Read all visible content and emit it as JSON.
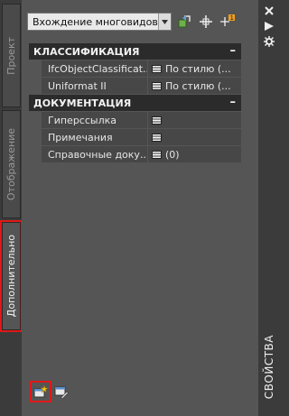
{
  "palette": {
    "title_text": "СВОЙСТВА"
  },
  "tabs": [
    {
      "label": "Проект",
      "active": false
    },
    {
      "label": "Отображение",
      "active": false
    },
    {
      "label": "Дополнительно",
      "active": true
    }
  ],
  "toolbar": {
    "combo_value": "Вхождение многовидово...",
    "icons": [
      "quick-select-icon",
      "select-objects-icon",
      "toggle-pickadd-icon"
    ]
  },
  "categories": [
    {
      "title": "КЛАССИФИКАЦИЯ",
      "collapse": "–",
      "rows": [
        {
          "name": "IfcObjectClassificat...",
          "value": "По стилю (...",
          "icon": "list-icon"
        },
        {
          "name": "Uniformat II",
          "value": "По стилю (...",
          "icon": "list-icon"
        }
      ]
    },
    {
      "title": "ДОКУМЕНТАЦИЯ",
      "collapse": "–",
      "rows": [
        {
          "name": "Гиперссылка",
          "value": "",
          "icon": "list-icon"
        },
        {
          "name": "Примечания",
          "value": "",
          "icon": "list-icon"
        },
        {
          "name": "Справочные доку...",
          "value": "(0)",
          "icon": "list-icon"
        }
      ]
    }
  ],
  "bottom_icons": [
    "add-style-icon",
    "edit-style-icon"
  ],
  "colors": {
    "highlight": "#e01818",
    "category_bg": "#2b2b2b",
    "panel_bg": "#555555"
  }
}
